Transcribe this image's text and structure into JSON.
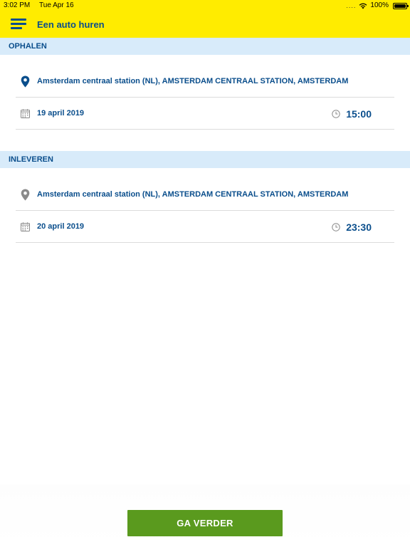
{
  "status_bar": {
    "time": "3:02 PM",
    "date": "Tue Apr 16",
    "signal": "....",
    "battery": "100%"
  },
  "navbar": {
    "title": "Een auto huren",
    "menu_icon": "hamburger-menu-icon",
    "background_color": "#ffec00",
    "accent_color": "#0a4e8c"
  },
  "pickup": {
    "header": "OPHALEN",
    "location": "Amsterdam centraal station (NL), AMSTERDAM CENTRAAL STATION, AMSTERDAM",
    "location_icon": "location-pin-icon",
    "location_icon_color": "#0a4e8c",
    "date": "19 april 2019",
    "time": "15:00"
  },
  "return": {
    "header": "INLEVEREN",
    "location": "Amsterdam centraal station (NL), AMSTERDAM CENTRAAL STATION, AMSTERDAM",
    "location_icon": "location-pin-icon",
    "location_icon_color": "#8a8a8a",
    "date": "20 april 2019",
    "time": "23:30"
  },
  "footer": {
    "continue_label": "GA VERDER",
    "continue_color": "#5a9a1e"
  }
}
